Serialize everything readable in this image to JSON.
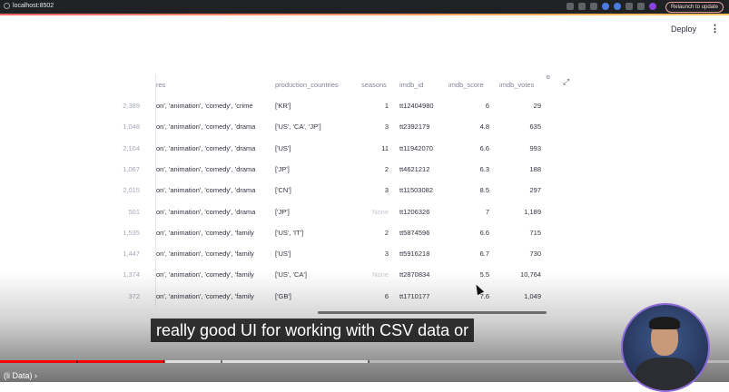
{
  "browser": {
    "url": "localhost:8502",
    "relaunch_label": "Relaunch to update"
  },
  "app": {
    "deploy_label": "Deploy",
    "menu_glyph": "⋮"
  },
  "table": {
    "headers": [
      "res",
      "production_countries",
      "seasons",
      "imdb_id",
      "imdb_score",
      "imdb_votes"
    ],
    "rows": [
      {
        "index": "2,389",
        "genres": "on', 'animation', 'comedy', 'crime",
        "countries": "['KR']",
        "seasons": "1",
        "imdb_id": "tt12404980",
        "score": "6",
        "votes": "29"
      },
      {
        "index": "1,048",
        "genres": "on', 'animation', 'comedy', 'drama",
        "countries": "['US', 'CA', 'JP']",
        "seasons": "3",
        "imdb_id": "tt2392179",
        "score": "4.8",
        "votes": "635"
      },
      {
        "index": "2,104",
        "genres": "on', 'animation', 'comedy', 'drama",
        "countries": "['US']",
        "seasons": "11",
        "imdb_id": "tt11942070",
        "score": "6.6",
        "votes": "993"
      },
      {
        "index": "1,067",
        "genres": "on', 'animation', 'comedy', 'drama",
        "countries": "['JP']",
        "seasons": "2",
        "imdb_id": "tt4621212",
        "score": "6.3",
        "votes": "188"
      },
      {
        "index": "2,015",
        "genres": "on', 'animation', 'comedy', 'drama",
        "countries": "['CN']",
        "seasons": "3",
        "imdb_id": "tt11503082",
        "score": "8.5",
        "votes": "297"
      },
      {
        "index": "501",
        "genres": "on', 'animation', 'comedy', 'drama",
        "countries": "['JP']",
        "seasons": "None",
        "imdb_id": "tt1206326",
        "score": "7",
        "votes": "1,189"
      },
      {
        "index": "1,535",
        "genres": "on', 'animation', 'comedy', 'family",
        "countries": "['US', 'IT']",
        "seasons": "2",
        "imdb_id": "tt5874596",
        "score": "6.6",
        "votes": "715"
      },
      {
        "index": "1,447",
        "genres": "on', 'animation', 'comedy', 'family",
        "countries": "['US']",
        "seasons": "3",
        "imdb_id": "tt5916218",
        "score": "6.7",
        "votes": "730"
      },
      {
        "index": "1,374",
        "genres": "on', 'animation', 'comedy', 'family",
        "countries": "['US', 'CA']",
        "seasons": "None",
        "imdb_id": "tt2870834",
        "score": "5.5",
        "votes": "10,764"
      },
      {
        "index": "372",
        "genres": "on', 'animation', 'comedy', 'family",
        "countries": "['GB']",
        "seasons": "6",
        "imdb_id": "tt1710177",
        "score": "7.6",
        "votes": "1,049"
      }
    ]
  },
  "video": {
    "caption": "really good UI for working with CSV data or",
    "chapter": "(li Data) ›",
    "played_fraction": 0.225,
    "buffered_fraction": 0.505
  },
  "colors": {
    "accent": "#ff4b4b",
    "progress": "#ff0000"
  }
}
